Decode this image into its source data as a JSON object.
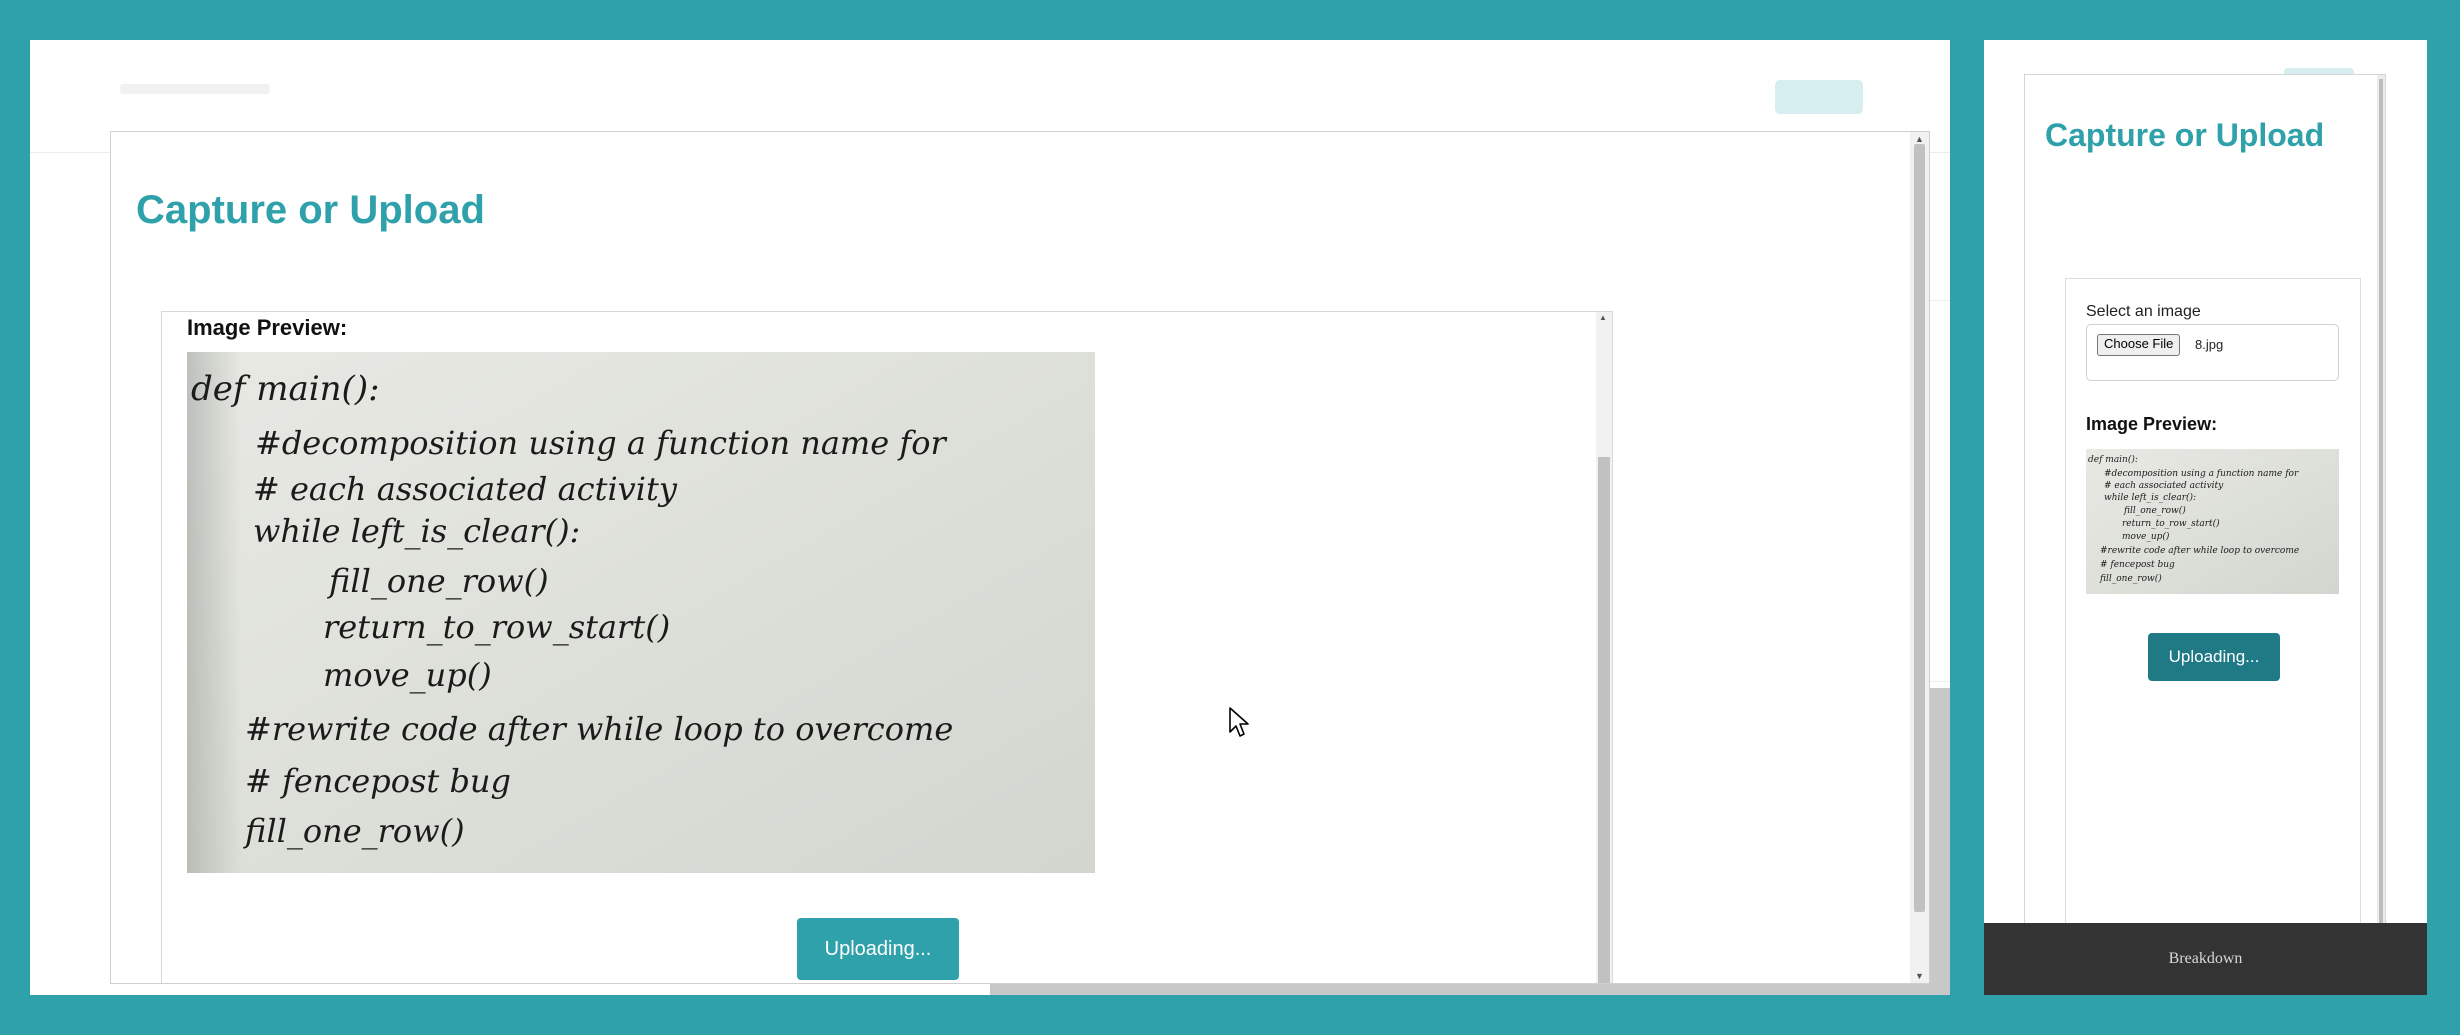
{
  "desktop": {
    "modal_title": "Capture or Upload",
    "preview_label": "Image Preview:",
    "upload_button": "Uploading..."
  },
  "mobile": {
    "modal_title": "Capture or Upload",
    "select_label": "Select an image",
    "choose_file_button": "Choose File",
    "file_name": "8.jpg",
    "preview_label": "Image Preview:",
    "upload_button": "Uploading...",
    "footer_link": "Breakdown"
  },
  "handwritten_image": {
    "lines": [
      "def main():",
      "#decomposition using a function name for",
      "# each associated activity",
      "while left_is_clear():",
      "fill_one_row()",
      "return_to_row_start()",
      "move_up()",
      "#rewrite code after while loop to overcome",
      "# fencepost bug",
      "fill_one_row()"
    ]
  },
  "colors": {
    "teal_background": "#2fa1aa",
    "title_teal": "#2fa1aa",
    "desktop_button": "#2fa1aa",
    "mobile_button": "#1f7a86",
    "footer_bg": "#333333"
  }
}
